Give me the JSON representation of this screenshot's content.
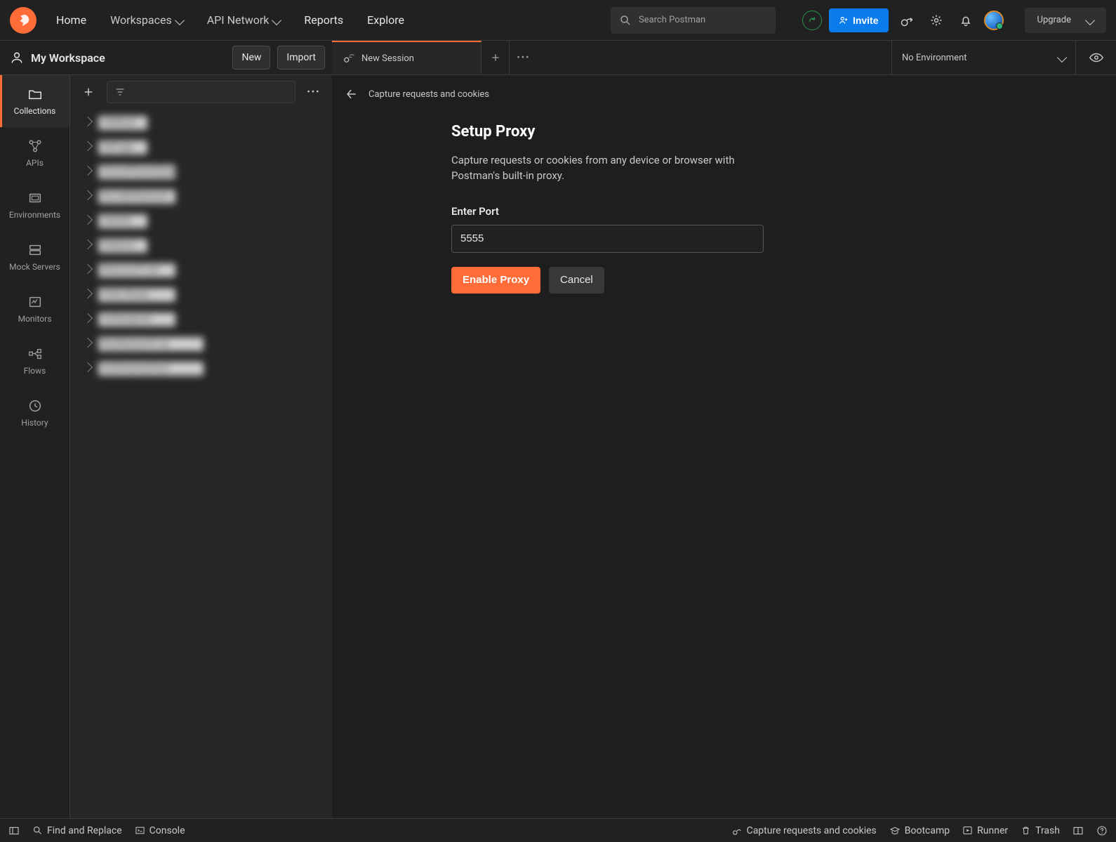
{
  "header": {
    "nav": {
      "home": "Home",
      "workspaces": "Workspaces",
      "api_network": "API Network",
      "reports": "Reports",
      "explore": "Explore"
    },
    "search_placeholder": "Search Postman",
    "invite": "Invite",
    "upgrade": "Upgrade"
  },
  "workspace": {
    "title": "My Workspace",
    "new_btn": "New",
    "import_btn": "Import"
  },
  "tab": {
    "label": "New Session"
  },
  "environment": {
    "selected": "No Environment"
  },
  "rail": {
    "collections": "Collections",
    "apis": "APIs",
    "environments": "Environments",
    "mock_servers": "Mock Servers",
    "monitors": "Monitors",
    "flows": "Flows",
    "history": "History"
  },
  "collections": [
    "VelModi",
    "SitFuga",
    "OmnoPloremQuas",
    "Dui definkansutr",
    "VelitAb",
    "IstIpson",
    "RemLaciTt laf",
    "Volly Ruase",
    "Vuifacigmat",
    "Noafierpwcht xp",
    "InoHerytoasiluut"
  ],
  "crumb": {
    "back_label": "Capture requests and cookies"
  },
  "panel": {
    "title": "Setup Proxy",
    "description": "Capture requests or cookies from any device or browser with Postman's built-in proxy.",
    "port_label": "Enter Port",
    "port_value": "5555",
    "enable": "Enable Proxy",
    "cancel": "Cancel"
  },
  "footer": {
    "find": "Find and Replace",
    "console": "Console",
    "capture": "Capture requests and cookies",
    "bootcamp": "Bootcamp",
    "runner": "Runner",
    "trash": "Trash"
  }
}
